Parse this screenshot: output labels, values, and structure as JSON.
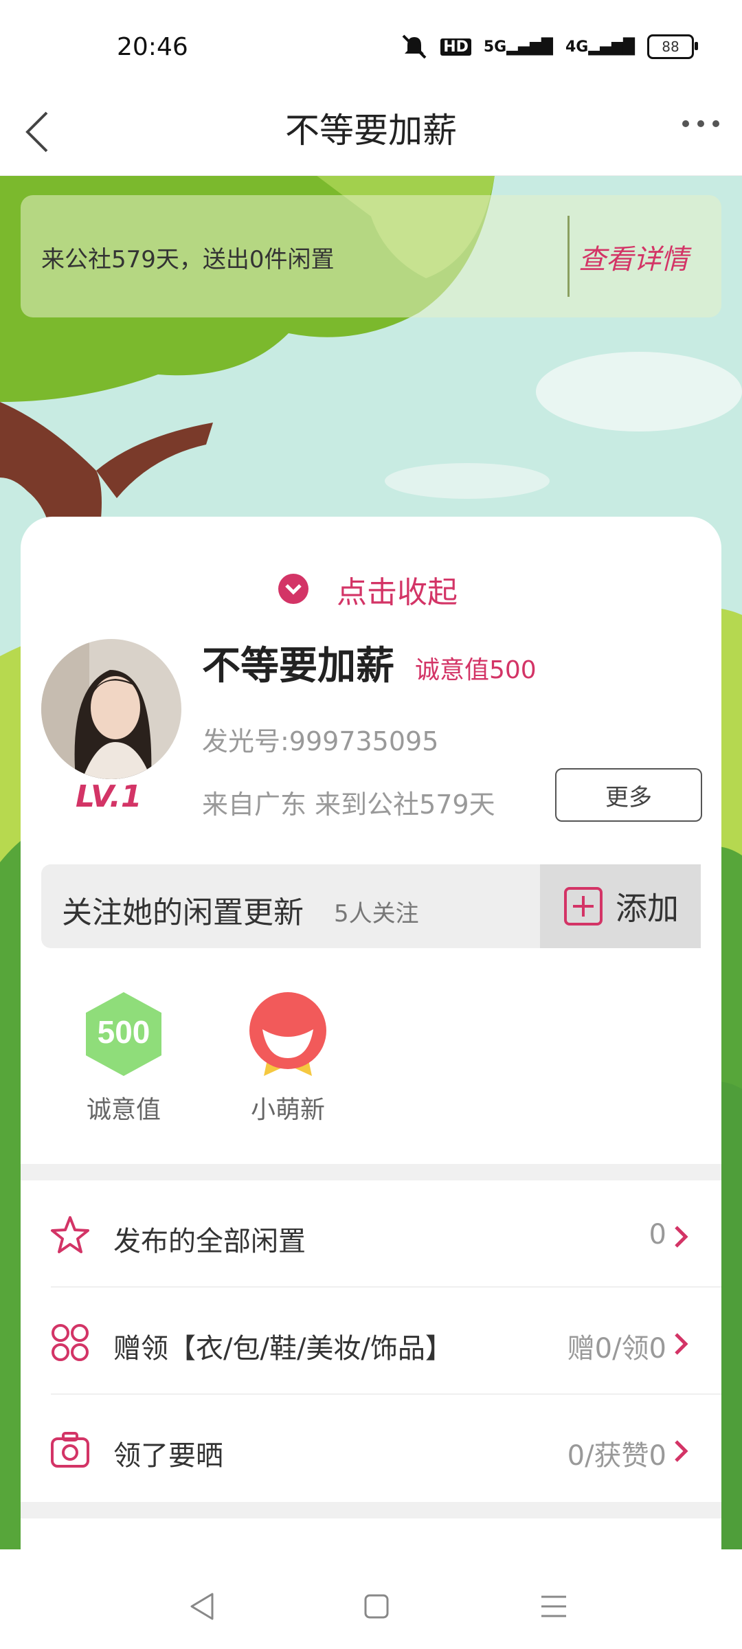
{
  "status_bar": {
    "time": "20:46",
    "icons": [
      "mute-icon",
      "hd-icon",
      "signal-5g-icon",
      "signal-4g-icon",
      "battery-icon"
    ],
    "hd_label": "HD",
    "net1_label": "5G",
    "net2_label": "4G",
    "battery_level": "88"
  },
  "header": {
    "title": "不等要加薪"
  },
  "banner": {
    "text": "来公社579天，送出0件闲置",
    "link_label": "查看详情"
  },
  "collapse": {
    "label": "点击收起"
  },
  "profile": {
    "name": "不等要加薪",
    "sincerity_tag": "诚意值500",
    "id_text": "发光号:999735095",
    "origin_text": "来自广东 来到公社579天",
    "level": "LV.1",
    "more_label": "更多"
  },
  "follow": {
    "title": "关注她的闲置更新",
    "count": "5人关注",
    "add_label": "添加"
  },
  "badges": [
    {
      "value": "500",
      "label": "诚意值",
      "color": "#8fdd7a"
    },
    {
      "label": "小萌新",
      "color": "#f25a5a"
    }
  ],
  "rows": [
    {
      "icon": "star-icon",
      "label": "发布的全部闲置",
      "value": "0"
    },
    {
      "icon": "grid-icon",
      "label": "赠领【衣/包/鞋/美妆/饰品】",
      "value": "赠0/领0"
    },
    {
      "icon": "camera-icon",
      "label": "领了要晒",
      "value": "0/获赞0"
    }
  ],
  "colors": {
    "accent": "#d33466",
    "sky": "#c9ece0",
    "grass": "#9fce45",
    "tree": "#7cbb2e"
  }
}
